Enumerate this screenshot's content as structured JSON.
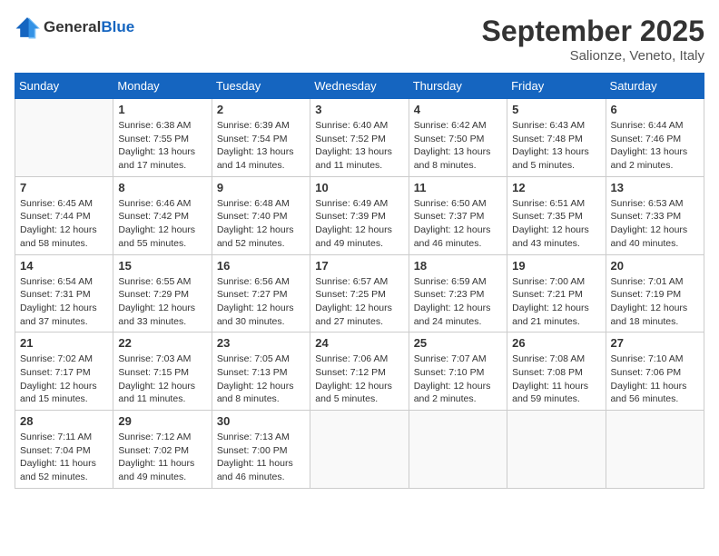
{
  "header": {
    "logo_general": "General",
    "logo_blue": "Blue",
    "month_title": "September 2025",
    "subtitle": "Salionze, Veneto, Italy"
  },
  "weekdays": [
    "Sunday",
    "Monday",
    "Tuesday",
    "Wednesday",
    "Thursday",
    "Friday",
    "Saturday"
  ],
  "weeks": [
    [
      {
        "day": "",
        "sunrise": "",
        "sunset": "",
        "daylight": ""
      },
      {
        "day": "1",
        "sunrise": "Sunrise: 6:38 AM",
        "sunset": "Sunset: 7:55 PM",
        "daylight": "Daylight: 13 hours and 17 minutes."
      },
      {
        "day": "2",
        "sunrise": "Sunrise: 6:39 AM",
        "sunset": "Sunset: 7:54 PM",
        "daylight": "Daylight: 13 hours and 14 minutes."
      },
      {
        "day": "3",
        "sunrise": "Sunrise: 6:40 AM",
        "sunset": "Sunset: 7:52 PM",
        "daylight": "Daylight: 13 hours and 11 minutes."
      },
      {
        "day": "4",
        "sunrise": "Sunrise: 6:42 AM",
        "sunset": "Sunset: 7:50 PM",
        "daylight": "Daylight: 13 hours and 8 minutes."
      },
      {
        "day": "5",
        "sunrise": "Sunrise: 6:43 AM",
        "sunset": "Sunset: 7:48 PM",
        "daylight": "Daylight: 13 hours and 5 minutes."
      },
      {
        "day": "6",
        "sunrise": "Sunrise: 6:44 AM",
        "sunset": "Sunset: 7:46 PM",
        "daylight": "Daylight: 13 hours and 2 minutes."
      }
    ],
    [
      {
        "day": "7",
        "sunrise": "Sunrise: 6:45 AM",
        "sunset": "Sunset: 7:44 PM",
        "daylight": "Daylight: 12 hours and 58 minutes."
      },
      {
        "day": "8",
        "sunrise": "Sunrise: 6:46 AM",
        "sunset": "Sunset: 7:42 PM",
        "daylight": "Daylight: 12 hours and 55 minutes."
      },
      {
        "day": "9",
        "sunrise": "Sunrise: 6:48 AM",
        "sunset": "Sunset: 7:40 PM",
        "daylight": "Daylight: 12 hours and 52 minutes."
      },
      {
        "day": "10",
        "sunrise": "Sunrise: 6:49 AM",
        "sunset": "Sunset: 7:39 PM",
        "daylight": "Daylight: 12 hours and 49 minutes."
      },
      {
        "day": "11",
        "sunrise": "Sunrise: 6:50 AM",
        "sunset": "Sunset: 7:37 PM",
        "daylight": "Daylight: 12 hours and 46 minutes."
      },
      {
        "day": "12",
        "sunrise": "Sunrise: 6:51 AM",
        "sunset": "Sunset: 7:35 PM",
        "daylight": "Daylight: 12 hours and 43 minutes."
      },
      {
        "day": "13",
        "sunrise": "Sunrise: 6:53 AM",
        "sunset": "Sunset: 7:33 PM",
        "daylight": "Daylight: 12 hours and 40 minutes."
      }
    ],
    [
      {
        "day": "14",
        "sunrise": "Sunrise: 6:54 AM",
        "sunset": "Sunset: 7:31 PM",
        "daylight": "Daylight: 12 hours and 37 minutes."
      },
      {
        "day": "15",
        "sunrise": "Sunrise: 6:55 AM",
        "sunset": "Sunset: 7:29 PM",
        "daylight": "Daylight: 12 hours and 33 minutes."
      },
      {
        "day": "16",
        "sunrise": "Sunrise: 6:56 AM",
        "sunset": "Sunset: 7:27 PM",
        "daylight": "Daylight: 12 hours and 30 minutes."
      },
      {
        "day": "17",
        "sunrise": "Sunrise: 6:57 AM",
        "sunset": "Sunset: 7:25 PM",
        "daylight": "Daylight: 12 hours and 27 minutes."
      },
      {
        "day": "18",
        "sunrise": "Sunrise: 6:59 AM",
        "sunset": "Sunset: 7:23 PM",
        "daylight": "Daylight: 12 hours and 24 minutes."
      },
      {
        "day": "19",
        "sunrise": "Sunrise: 7:00 AM",
        "sunset": "Sunset: 7:21 PM",
        "daylight": "Daylight: 12 hours and 21 minutes."
      },
      {
        "day": "20",
        "sunrise": "Sunrise: 7:01 AM",
        "sunset": "Sunset: 7:19 PM",
        "daylight": "Daylight: 12 hours and 18 minutes."
      }
    ],
    [
      {
        "day": "21",
        "sunrise": "Sunrise: 7:02 AM",
        "sunset": "Sunset: 7:17 PM",
        "daylight": "Daylight: 12 hours and 15 minutes."
      },
      {
        "day": "22",
        "sunrise": "Sunrise: 7:03 AM",
        "sunset": "Sunset: 7:15 PM",
        "daylight": "Daylight: 12 hours and 11 minutes."
      },
      {
        "day": "23",
        "sunrise": "Sunrise: 7:05 AM",
        "sunset": "Sunset: 7:13 PM",
        "daylight": "Daylight: 12 hours and 8 minutes."
      },
      {
        "day": "24",
        "sunrise": "Sunrise: 7:06 AM",
        "sunset": "Sunset: 7:12 PM",
        "daylight": "Daylight: 12 hours and 5 minutes."
      },
      {
        "day": "25",
        "sunrise": "Sunrise: 7:07 AM",
        "sunset": "Sunset: 7:10 PM",
        "daylight": "Daylight: 12 hours and 2 minutes."
      },
      {
        "day": "26",
        "sunrise": "Sunrise: 7:08 AM",
        "sunset": "Sunset: 7:08 PM",
        "daylight": "Daylight: 11 hours and 59 minutes."
      },
      {
        "day": "27",
        "sunrise": "Sunrise: 7:10 AM",
        "sunset": "Sunset: 7:06 PM",
        "daylight": "Daylight: 11 hours and 56 minutes."
      }
    ],
    [
      {
        "day": "28",
        "sunrise": "Sunrise: 7:11 AM",
        "sunset": "Sunset: 7:04 PM",
        "daylight": "Daylight: 11 hours and 52 minutes."
      },
      {
        "day": "29",
        "sunrise": "Sunrise: 7:12 AM",
        "sunset": "Sunset: 7:02 PM",
        "daylight": "Daylight: 11 hours and 49 minutes."
      },
      {
        "day": "30",
        "sunrise": "Sunrise: 7:13 AM",
        "sunset": "Sunset: 7:00 PM",
        "daylight": "Daylight: 11 hours and 46 minutes."
      },
      {
        "day": "",
        "sunrise": "",
        "sunset": "",
        "daylight": ""
      },
      {
        "day": "",
        "sunrise": "",
        "sunset": "",
        "daylight": ""
      },
      {
        "day": "",
        "sunrise": "",
        "sunset": "",
        "daylight": ""
      },
      {
        "day": "",
        "sunrise": "",
        "sunset": "",
        "daylight": ""
      }
    ]
  ]
}
